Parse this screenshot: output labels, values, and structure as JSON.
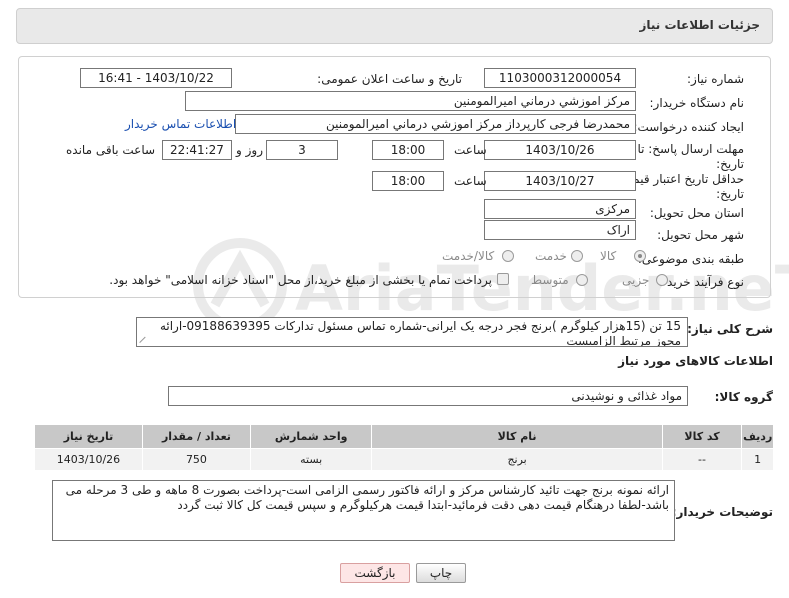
{
  "header": {
    "title": "جزئیات اطلاعات نیاز"
  },
  "form": {
    "need_number_label": "شماره نیاز:",
    "need_number": "1103000312000054",
    "announce_label": "تاریخ و ساعت اعلان عمومی:",
    "announce_value": "1403/10/22 - 16:41",
    "buyer_org_label": "نام دستگاه خریدار:",
    "buyer_org": "مرکز اموزشي درماني اميرالمومنين",
    "creator_label": "ایجاد کننده درخواست:",
    "creator": "محمدرضا فرجی کارپرداز مرکز اموزشي درماني اميرالمومنين",
    "contact_link": "اطلاعات تماس خریدار",
    "deadline_label_1": "مهلت ارسال پاسخ: تا",
    "deadline_label_2": "تاریخ:",
    "deadline_date": "1403/10/26",
    "time_label": "ساعت",
    "deadline_time": "18:00",
    "days_value": "3",
    "days_label": "روز و",
    "remaining_time": "22:41:27",
    "remaining_label": "ساعت باقی مانده",
    "validity_label_1": "حداقل تاریخ اعتبار قیمت: تا",
    "validity_label_2": "تاریخ:",
    "validity_date": "1403/10/27",
    "validity_time": "18:00",
    "province_label": "استان محل تحویل:",
    "province": "مرکزی",
    "city_label": "شهر محل تحویل:",
    "city": "اراک",
    "category_label": "طبقه بندی موضوعی:",
    "category_options": [
      "کالا",
      "خدمت",
      "کالا/خدمت"
    ],
    "category_selected": "کالا",
    "process_label": "نوع فرآیند خرید :",
    "process_options": [
      "جزیی",
      "متوسط"
    ],
    "payment_note": "پرداخت تمام یا بخشی از مبلغ خرید،از محل \"اسناد خزانه اسلامی\" خواهد بود."
  },
  "description": {
    "label": "شرح کلی نیاز:",
    "text": "15 تن (15هزار کیلوگرم )برنج فجر درجه یک ایرانی-شماره تماس مسئول تدارکات 09188639395-ارائه مجوز مرتبط الزامیست"
  },
  "goods_info": {
    "title": "اطلاعات کالاهای مورد نیاز",
    "group_label": "گروه کالا:",
    "group_value": "مواد غذائی و نوشیدنی"
  },
  "table": {
    "headers": [
      "ردیف",
      "کد کالا",
      "نام کالا",
      "واحد شمارش",
      "تعداد / مقدار",
      "تاریخ نیاز"
    ],
    "rows": [
      [
        "1",
        "--",
        "برنج",
        "بسته",
        "750",
        "1403/10/26"
      ]
    ]
  },
  "buyer_notes": {
    "label": "توضیحات خریدار:",
    "text": "ارائه نمونه برنج جهت تائید کارشناس مرکز و ارائه فاکتور رسمی الزامی است-پرداخت بصورت 8 ماهه و طی 3 مرحله می باشد-لطفا درهنگام قیمت دهی دقت فرمائید-ابتدا قیمت هرکیلوگرم و سپس قیمت کل کالا ثبت گردد"
  },
  "buttons": {
    "print": "چاپ",
    "back": "بازگشت"
  },
  "watermark": "AriaTender.neT"
}
